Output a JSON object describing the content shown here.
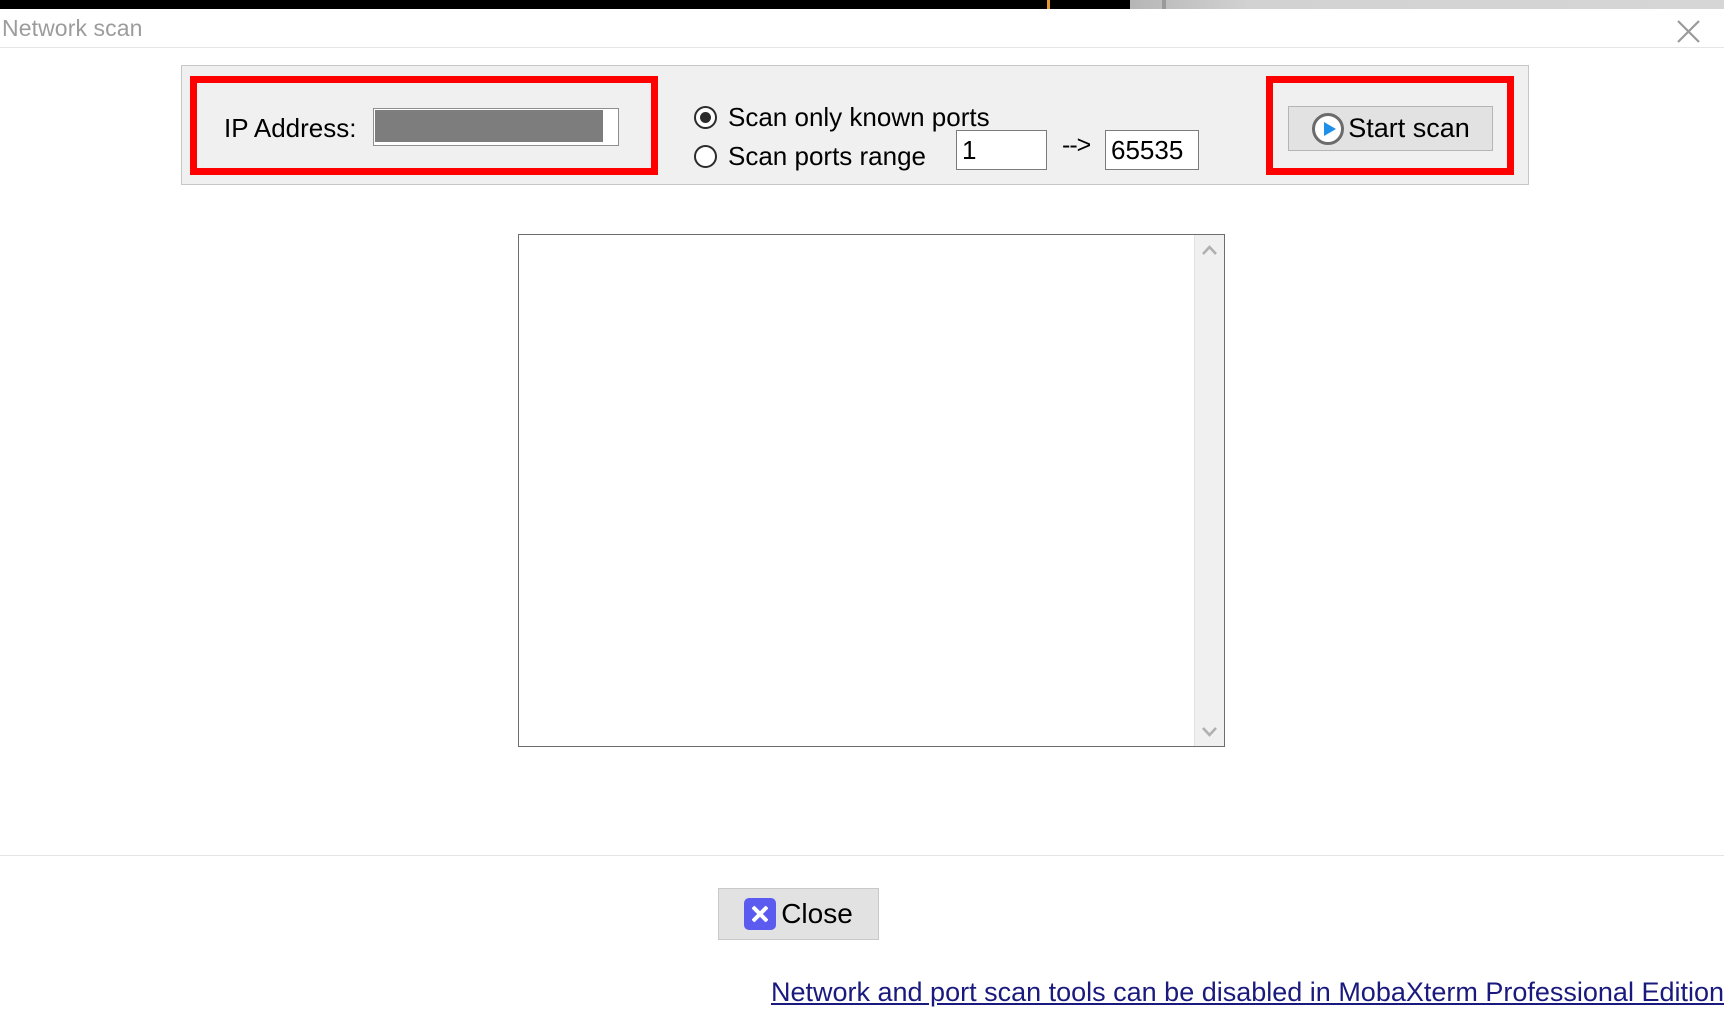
{
  "window": {
    "title": "Network scan",
    "close_icon": "close-x-icon"
  },
  "options": {
    "ip_label": "IP Address:",
    "ip_value": "",
    "ip_placeholder": "",
    "ip_redacted": true,
    "scan_mode_selected": "known",
    "radio_known_label": "Scan only known ports",
    "radio_range_label": "Scan ports range",
    "port_start": "1",
    "port_arrow": "-->",
    "port_end": "65535",
    "start_scan_label": "Start scan",
    "start_scan_icon": "play-circle-icon"
  },
  "results": {
    "text": "",
    "scroll_up_icon": "chevron-up-icon",
    "scroll_down_icon": "chevron-down-icon"
  },
  "footer": {
    "close_label": "Close",
    "close_icon": "x-square-icon",
    "promo_link": "Network and port scan tools can be disabled in MobaXterm Professional Edition"
  },
  "colors": {
    "highlight": "#fe0000",
    "panel_bg": "#f0f0f0",
    "accent_blue": "#2196f3",
    "close_icon_bg": "#5b5bf0",
    "link": "#1a1a7e",
    "title_text": "#9c9c9c"
  }
}
